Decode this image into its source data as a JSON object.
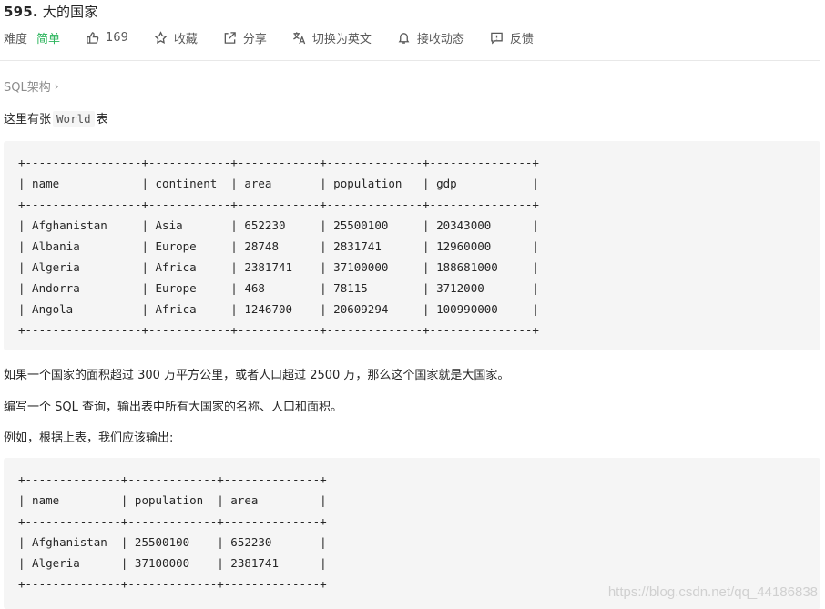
{
  "problem": {
    "number": "595.",
    "title": "大的国家"
  },
  "meta": {
    "difficulty_label": "难度",
    "difficulty_value": "简单",
    "likes": "169",
    "favorite": "收藏",
    "share": "分享",
    "switch_lang": "切换为英文",
    "notify": "接收动态",
    "feedback": "反馈"
  },
  "breadcrumb": {
    "label": "SQL架构"
  },
  "intro": {
    "prefix": "这里有张",
    "table_name": "World",
    "suffix": "表"
  },
  "world_table_text": "+-----------------+------------+------------+--------------+---------------+\n| name            | continent  | area       | population   | gdp           |\n+-----------------+------------+------------+--------------+---------------+\n| Afghanistan     | Asia       | 652230     | 25500100     | 20343000      |\n| Albania         | Europe     | 28748      | 2831741      | 12960000      |\n| Algeria         | Africa     | 2381741    | 37100000     | 188681000     |\n| Andorra         | Europe     | 468        | 78115        | 3712000       |\n| Angola          | Africa     | 1246700    | 20609294     | 100990000     |\n+-----------------+------------+------------+--------------+---------------+",
  "para1": "如果一个国家的面积超过 300 万平方公里，或者人口超过 2500 万，那么这个国家就是大国家。",
  "para2": "编写一个 SQL 查询，输出表中所有大国家的名称、人口和面积。",
  "para3": "例如，根据上表，我们应该输出:",
  "output_table_text": "+--------------+-------------+--------------+\n| name         | population  | area         |\n+--------------+-------------+--------------+\n| Afghanistan  | 25500100    | 652230       |\n| Algeria      | 37100000    | 2381741      |\n+--------------+-------------+--------------+",
  "watermark": "https://blog.csdn.net/qq_44186838",
  "colors": {
    "difficulty_easy": "#2db55d",
    "code_bg": "#f5f5f5",
    "muted": "#8c8c8c"
  }
}
